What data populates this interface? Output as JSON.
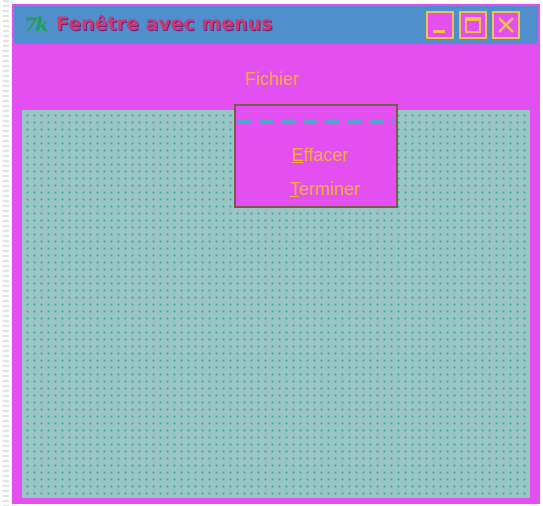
{
  "window": {
    "icon": "tk-feather-icon",
    "title": "Fenêtre avec menus",
    "buttons": [
      "minimize",
      "maximize",
      "close"
    ]
  },
  "menubar": {
    "items": [
      {
        "label": "Fichier"
      }
    ]
  },
  "dropdown": {
    "tearoff": true,
    "items": [
      {
        "mnemonic": "E",
        "rest": "ffacer"
      },
      {
        "mnemonic": "T",
        "rest": "erminer"
      }
    ]
  },
  "colors": {
    "window_bg": "#e44ff2",
    "titlebar": "#4f8fcb",
    "title_text": "#c93b6e",
    "menu_text": "#f2b02e",
    "client_bg": "#9bc4c4",
    "client_dots": "#2fb3a8",
    "button_border": "#f0c24a"
  }
}
